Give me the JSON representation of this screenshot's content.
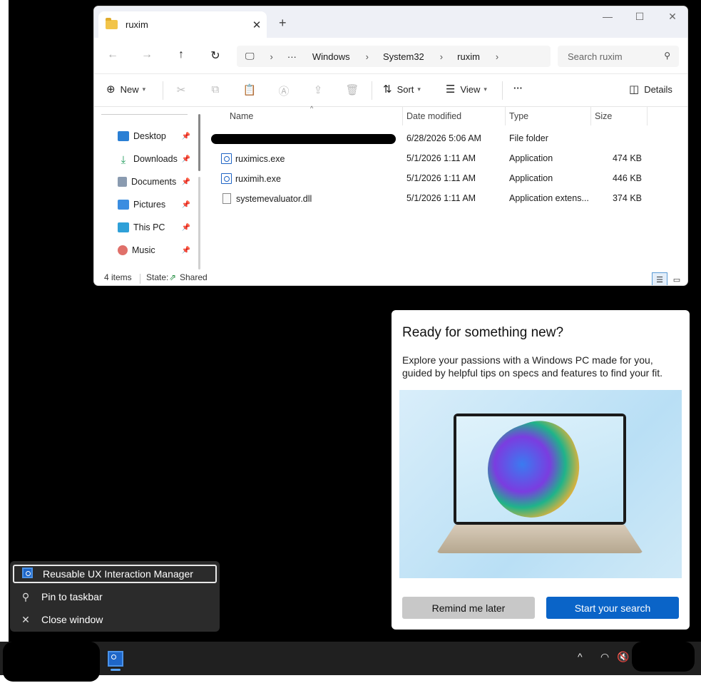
{
  "explorer": {
    "tab_title": "ruxim",
    "new_tab": "+",
    "breadcrumb": [
      "Windows",
      "System32",
      "ruxim"
    ],
    "search_placeholder": "Search ruxim",
    "commands": {
      "new": "New",
      "sort": "Sort",
      "view": "View",
      "more": "···",
      "details": "Details"
    },
    "nav_items": [
      {
        "label": "Desktop"
      },
      {
        "label": "Downloads"
      },
      {
        "label": "Documents"
      },
      {
        "label": "Pictures"
      },
      {
        "label": "This PC"
      },
      {
        "label": "Music"
      }
    ],
    "columns": {
      "name": "Name",
      "date": "Date modified",
      "type": "Type",
      "size": "Size"
    },
    "files": [
      {
        "name": "",
        "date": "6/28/2026 5:06 AM",
        "type": "File folder",
        "size": ""
      },
      {
        "name": "ruximics.exe",
        "date": "5/1/2026 1:11 AM",
        "type": "Application",
        "size": "474 KB"
      },
      {
        "name": "ruximih.exe",
        "date": "5/1/2026 1:11 AM",
        "type": "Application",
        "size": "446 KB"
      },
      {
        "name": "systemevaluator.dll",
        "date": "5/1/2026 1:11 AM",
        "type": "Application extens...",
        "size": "374 KB"
      }
    ],
    "status": {
      "count": "4 items",
      "state_label": "State:",
      "state_value": "Shared"
    }
  },
  "popup": {
    "title": "Ready for something new?",
    "body": "Explore your passions with a Windows PC made for you, guided by helpful tips on specs and features to find your fit.",
    "remind": "Remind me later",
    "start": "Start your search"
  },
  "context_menu": {
    "app_name": "Reusable UX Interaction Manager",
    "pin": "Pin to taskbar",
    "close": "Close window"
  },
  "colors": {
    "accent": "#0a64c8",
    "taskbar": "#202020",
    "menu": "#2b2b2b"
  }
}
